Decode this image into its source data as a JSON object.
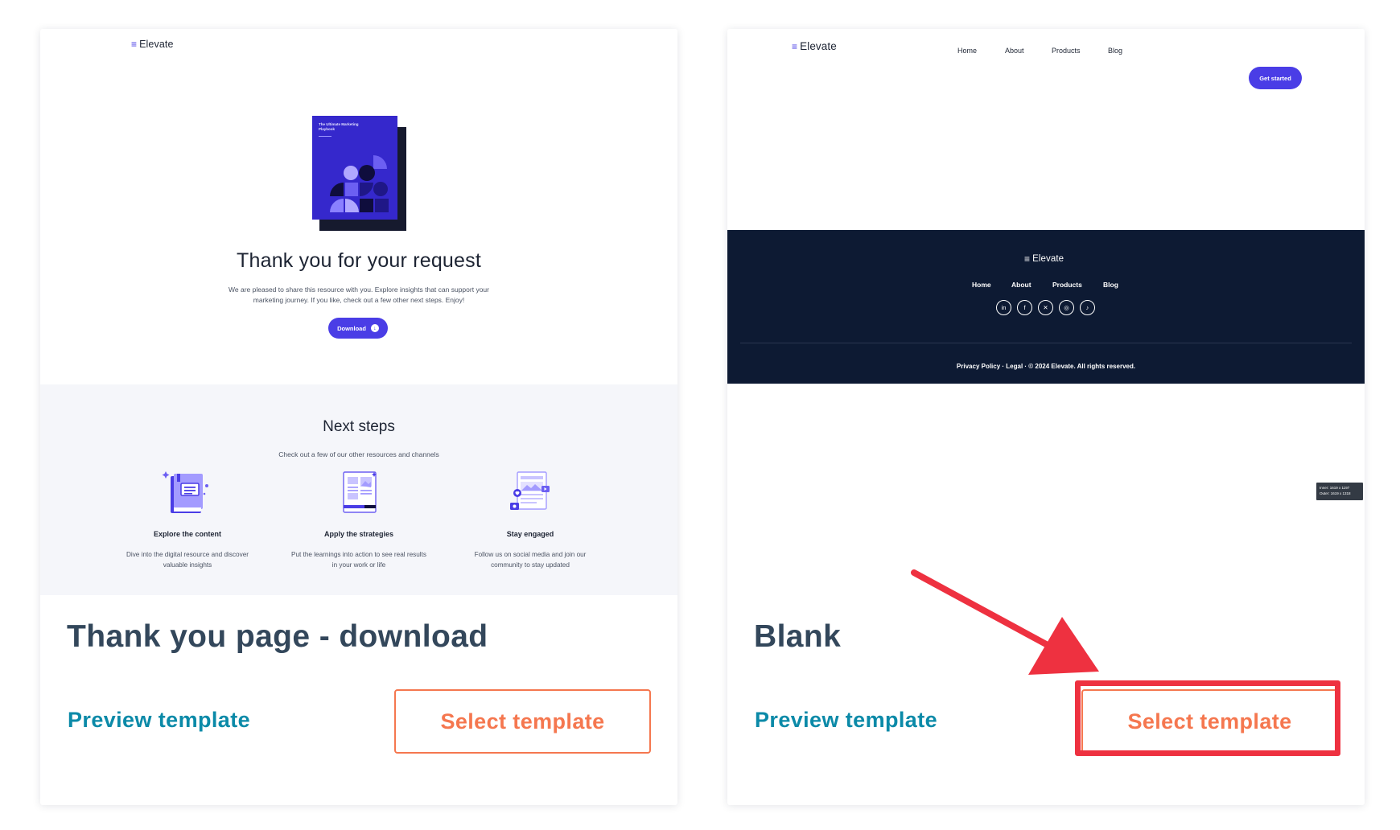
{
  "cards": [
    {
      "title": "Thank you page - download",
      "preview_link": "Preview template",
      "select_label": "Select template",
      "preview": {
        "logo": "Elevate",
        "book_title": "The Ultimate Marketing Playbook",
        "heading": "Thank you for your request",
        "body": "We are pleased to share this resource with you. Explore insights that can support your marketing journey. If you like, check out a few other next steps. Enjoy!",
        "download_label": "Download",
        "next_steps_title": "Next steps",
        "next_steps_subtitle": "Check out a few of our other resources and channels",
        "steps": [
          {
            "title": "Explore the content",
            "desc": "Dive into the digital resource and discover valuable insights"
          },
          {
            "title": "Apply the strategies",
            "desc": "Put the learnings into action to see real results in your work or life"
          },
          {
            "title": "Stay engaged",
            "desc": "Follow us on social media and join our community to stay updated"
          }
        ]
      }
    },
    {
      "title": "Blank",
      "preview_link": "Preview template",
      "select_label": "Select template",
      "preview": {
        "logo": "Elevate",
        "nav": [
          "Home",
          "About",
          "Products",
          "Blog"
        ],
        "cta": "Get started",
        "footer_logo": "Elevate",
        "footer_nav": [
          "Home",
          "About",
          "Products",
          "Blog"
        ],
        "social_icons": [
          "linkedin-icon",
          "facebook-icon",
          "x-icon",
          "instagram-icon",
          "tiktok-icon"
        ],
        "copyright": "Privacy Policy · Legal · © 2024 Elevate. All rights reserved.",
        "dimensions_inner": "Inner: 1619 x 1197",
        "dimensions_outer": "Outer: 1619 x 1318"
      }
    }
  ],
  "colors": {
    "accent_purple": "#4a3de6",
    "preview_link_teal": "#0b8aa8",
    "select_orange": "#f5774f",
    "annotation_red": "#ee3140",
    "footer_navy": "#0d1a33"
  }
}
